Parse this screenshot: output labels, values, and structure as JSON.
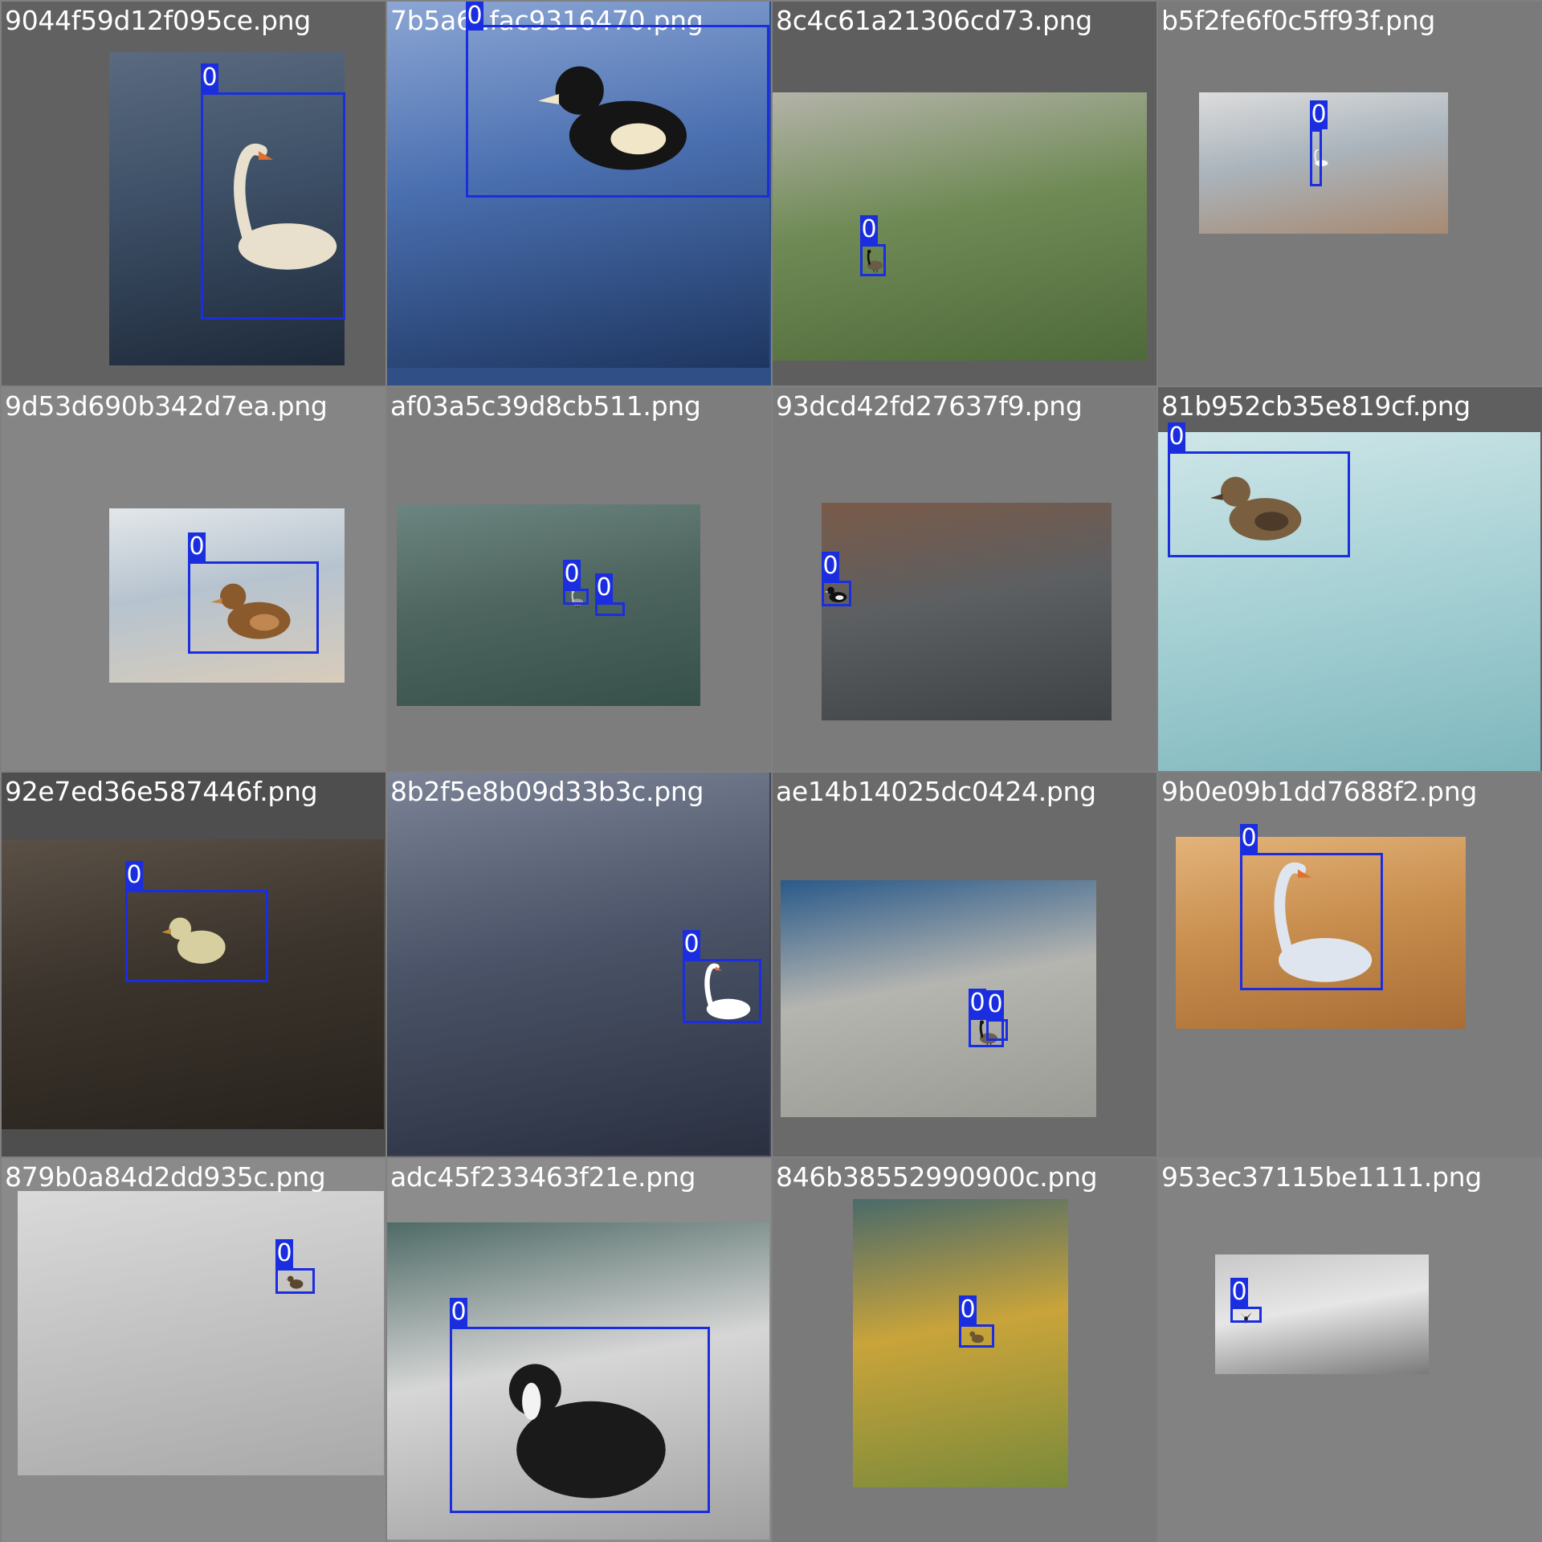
{
  "grid": {
    "tiles": [
      {
        "filename": "9044f59d12f095ce.png",
        "label": "0",
        "tile_bg": "#616161",
        "photo_colors": [
          "#3d4f66",
          "#1e2a3a",
          "#5a6b80"
        ],
        "subject_colors": [
          "#e8e0cc"
        ],
        "subject": "swan-icon"
      },
      {
        "filename": "7b5a61fac9316470.png",
        "label": "0",
        "tile_bg": "#2f4f86",
        "photo_colors": [
          "#4a6fb0",
          "#1e3660",
          "#8ca6d4"
        ],
        "subject_colors": [
          "#151515",
          "#f2e6c8"
        ],
        "subject": "duck-icon"
      },
      {
        "filename": "8c4c61a21306cd73.png",
        "label": "0",
        "tile_bg": "#5e5e5e",
        "photo_colors": [
          "#6f8a55",
          "#4f6a3a",
          "#b3b3a8"
        ],
        "subject_colors": [
          "#6a5a48",
          "#101010"
        ],
        "subject": "goose-icon"
      },
      {
        "filename": "b5f2fe6f0c5ff93f.png",
        "label": "0",
        "tile_bg": "#7a7a7a",
        "photo_colors": [
          "#aab4bc",
          "#a88a72",
          "#dcdcdc"
        ],
        "subject_colors": [
          "#f5f5f2"
        ],
        "subject": "swan-icon"
      },
      {
        "filename": "9d53d690b342d7ea.png",
        "label": "0",
        "tile_bg": "#858585",
        "photo_colors": [
          "#b6c3cf",
          "#d8ccba",
          "#e3e7ea"
        ],
        "subject_colors": [
          "#8a5a2c",
          "#c08850"
        ],
        "subject": "duck-icon"
      },
      {
        "filename": "af03a5c39d8cb511.png",
        "label": "0",
        "tile_bg": "#7d7d7d",
        "photo_colors": [
          "#4f6660",
          "#36504a",
          "#6d8580"
        ],
        "subject_colors": [
          "#9b9b98",
          "#d0d0cc"
        ],
        "subject": "goose-icon"
      },
      {
        "filename": "93dcd42fd27637f9.png",
        "label": "0",
        "tile_bg": "#7b7b7b",
        "photo_colors": [
          "#5c5f62",
          "#3f4245",
          "#7a5a48"
        ],
        "subject_colors": [
          "#111111",
          "#eeeeee"
        ],
        "subject": "duck-icon"
      },
      {
        "filename": "81b952cb35e819cf.png",
        "label": "0",
        "tile_bg": "#5f5f5f",
        "photo_colors": [
          "#a9d2d6",
          "#7eb7bd",
          "#cfe6e8"
        ],
        "subject_colors": [
          "#7a5e40",
          "#4e3a28"
        ],
        "subject": "duck-icon"
      },
      {
        "filename": "92e7ed36e587446f.png",
        "label": "0",
        "tile_bg": "#4e4e4e",
        "photo_colors": [
          "#3b342c",
          "#28231e",
          "#5a5046"
        ],
        "subject_colors": [
          "#d8cfa0"
        ],
        "subject": "duckling-icon"
      },
      {
        "filename": "8b2f5e8b09d33b3c.png",
        "label": "0",
        "tile_bg": "#3e4454",
        "photo_colors": [
          "#4b5468",
          "#2a3040",
          "#7c8396"
        ],
        "subject_colors": [
          "#ffffff"
        ],
        "subject": "swan-icon"
      },
      {
        "filename": "ae14b14025dc0424.png",
        "label": "0",
        "tile_bg": "#6a6a6a",
        "photo_colors": [
          "#b5b5b0",
          "#9a9a95",
          "#2a5a8a"
        ],
        "subject_colors": [
          "#6f5f4e",
          "#141414"
        ],
        "subject": "goose-icon"
      },
      {
        "filename": "9b0e09b1dd7688f2.png",
        "label": "0",
        "tile_bg": "#7c7c7c",
        "photo_colors": [
          "#c98f4f",
          "#a86d35",
          "#e3b37a"
        ],
        "subject_colors": [
          "#dfe5ef"
        ],
        "subject": "swan-icon"
      },
      {
        "filename": "879b0a84d2dd935c.png",
        "label": "0",
        "tile_bg": "#8a8a8a",
        "photo_colors": [
          "#c4c4c4",
          "#a9a9a9",
          "#dadada"
        ],
        "subject_colors": [
          "#5b4630"
        ],
        "subject": "duckling-icon"
      },
      {
        "filename": "adc45f233463f21e.png",
        "label": "0",
        "tile_bg": "#8c8c8c",
        "photo_colors": [
          "#d6d6d6",
          "#a0a0a0",
          "#4f6b66"
        ],
        "subject_colors": [
          "#1a1a1a",
          "#f3f3f3"
        ],
        "subject": "coot-icon"
      },
      {
        "filename": "846b38552990900c.png",
        "label": "0",
        "tile_bg": "#7a7a7a",
        "photo_colors": [
          "#c9a43a",
          "#7a8a3a",
          "#4a6a6a"
        ],
        "subject_colors": [
          "#6b5630"
        ],
        "subject": "duckling-icon"
      },
      {
        "filename": "953ec37115be1111.png",
        "label": "0",
        "tile_bg": "#828282",
        "photo_colors": [
          "#e6e6e6",
          "#7a7a7a",
          "#c8c8c8"
        ],
        "subject_colors": [
          "#1e1e1e"
        ],
        "subject": "cormorant-icon"
      }
    ]
  }
}
